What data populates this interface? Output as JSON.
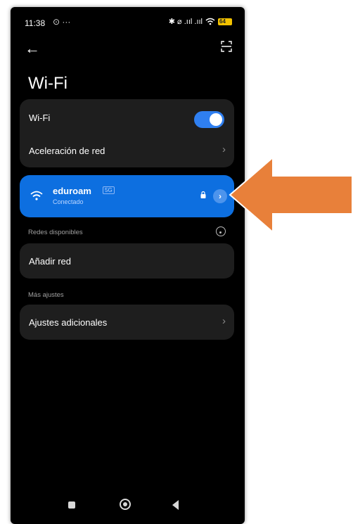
{
  "status_bar": {
    "time": "11:38",
    "left_icons": "⊙ ···",
    "right_icons": "✱ ⌀ .ııl .ııl",
    "battery": "64"
  },
  "header": {
    "title": "Wi-Fi"
  },
  "settings": {
    "wifi_label": "Wi-Fi",
    "wifi_enabled": true,
    "acceleration_label": "Aceleración de red"
  },
  "connected_network": {
    "ssid": "eduroam",
    "band": "5G",
    "status": "Conectado"
  },
  "available": {
    "section_label": "Redes disponibles",
    "add_network_label": "Añadir red"
  },
  "more": {
    "section_label": "Más ajustes",
    "additional_settings_label": "Ajustes adicionales"
  },
  "colors": {
    "accent": "#0d6fe0",
    "toggle": "#2f7ff0",
    "annotation_arrow": "#e8803a",
    "card": "#1e1e1e"
  }
}
